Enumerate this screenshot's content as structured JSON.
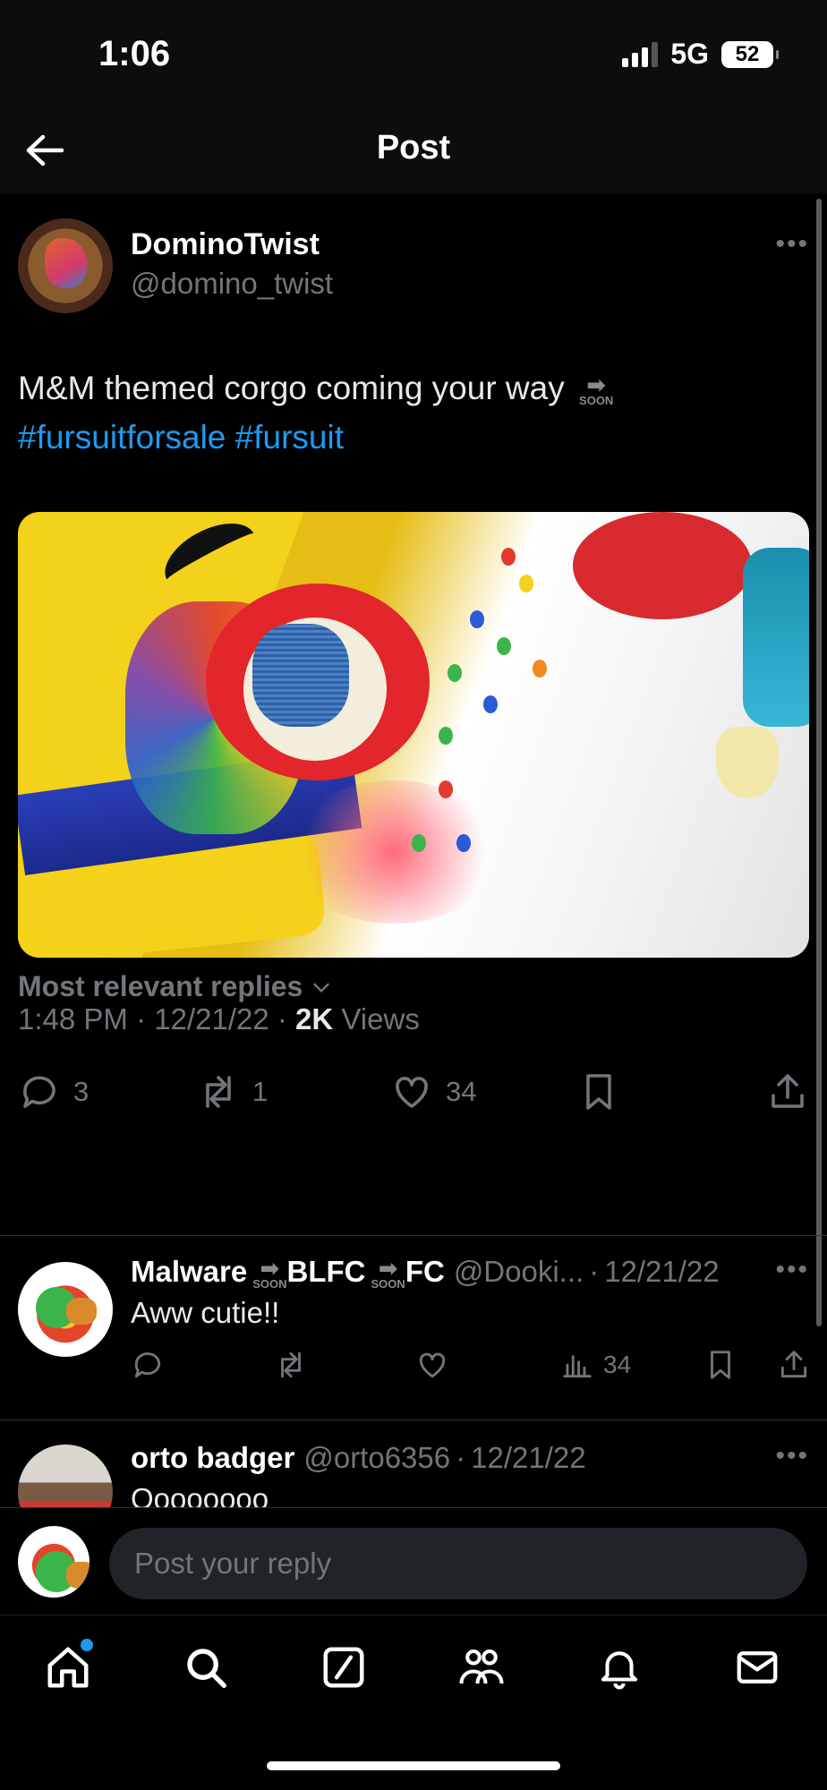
{
  "status_bar": {
    "time": "1:06",
    "network": "5G",
    "battery": "52"
  },
  "nav": {
    "title": "Post"
  },
  "post": {
    "author_name": "DominoTwist",
    "author_handle": "@domino_twist",
    "text_main": "M&M themed corgo coming your way",
    "soon_label": "SOON",
    "hashtags": [
      "#fursuitforsale",
      "#fursuit"
    ],
    "time": "1:48 PM",
    "date": "12/21/22",
    "views_count": "2K",
    "views_label": "Views",
    "replies": "3",
    "reposts": "1",
    "likes": "34"
  },
  "sort": {
    "label": "Most relevant replies"
  },
  "replies": [
    {
      "name_part1": "Malware",
      "name_part2": "BLFC",
      "name_part3": "FC",
      "handle": "@Dooki...",
      "date": "12/21/22",
      "text": "Aww cutie!!",
      "views": "34"
    },
    {
      "name": "orto badger",
      "handle": "@orto6356",
      "date": "12/21/22",
      "text": "Oooooooo"
    }
  ],
  "compose": {
    "placeholder": "Post your reply"
  },
  "colors": {
    "accent": "#1d9bf0",
    "muted": "#71767b",
    "background": "#000000"
  }
}
